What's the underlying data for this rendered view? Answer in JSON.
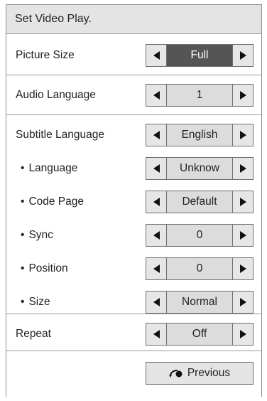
{
  "title": "Set Video Play.",
  "rows": [
    {
      "label": "Picture Size",
      "value": "Full"
    },
    {
      "label": "Audio Language",
      "value": "1"
    },
    {
      "label": "Subtitle Language",
      "value": "English"
    },
    {
      "label": "Language",
      "value": "Unknow"
    },
    {
      "label": "Code Page",
      "value": "Default"
    },
    {
      "label": "Sync",
      "value": "0"
    },
    {
      "label": "Position",
      "value": "0"
    },
    {
      "label": "Size",
      "value": "Normal"
    },
    {
      "label": "Repeat",
      "value": "Off"
    }
  ],
  "previous_button": {
    "label": "Previous",
    "icon": "back-arrow-icon"
  },
  "colors": {
    "title_bar": "#e4e4e4",
    "selected_value": "#555555",
    "value_bg": "#dcdcdc",
    "border": "#6f6f6f"
  }
}
